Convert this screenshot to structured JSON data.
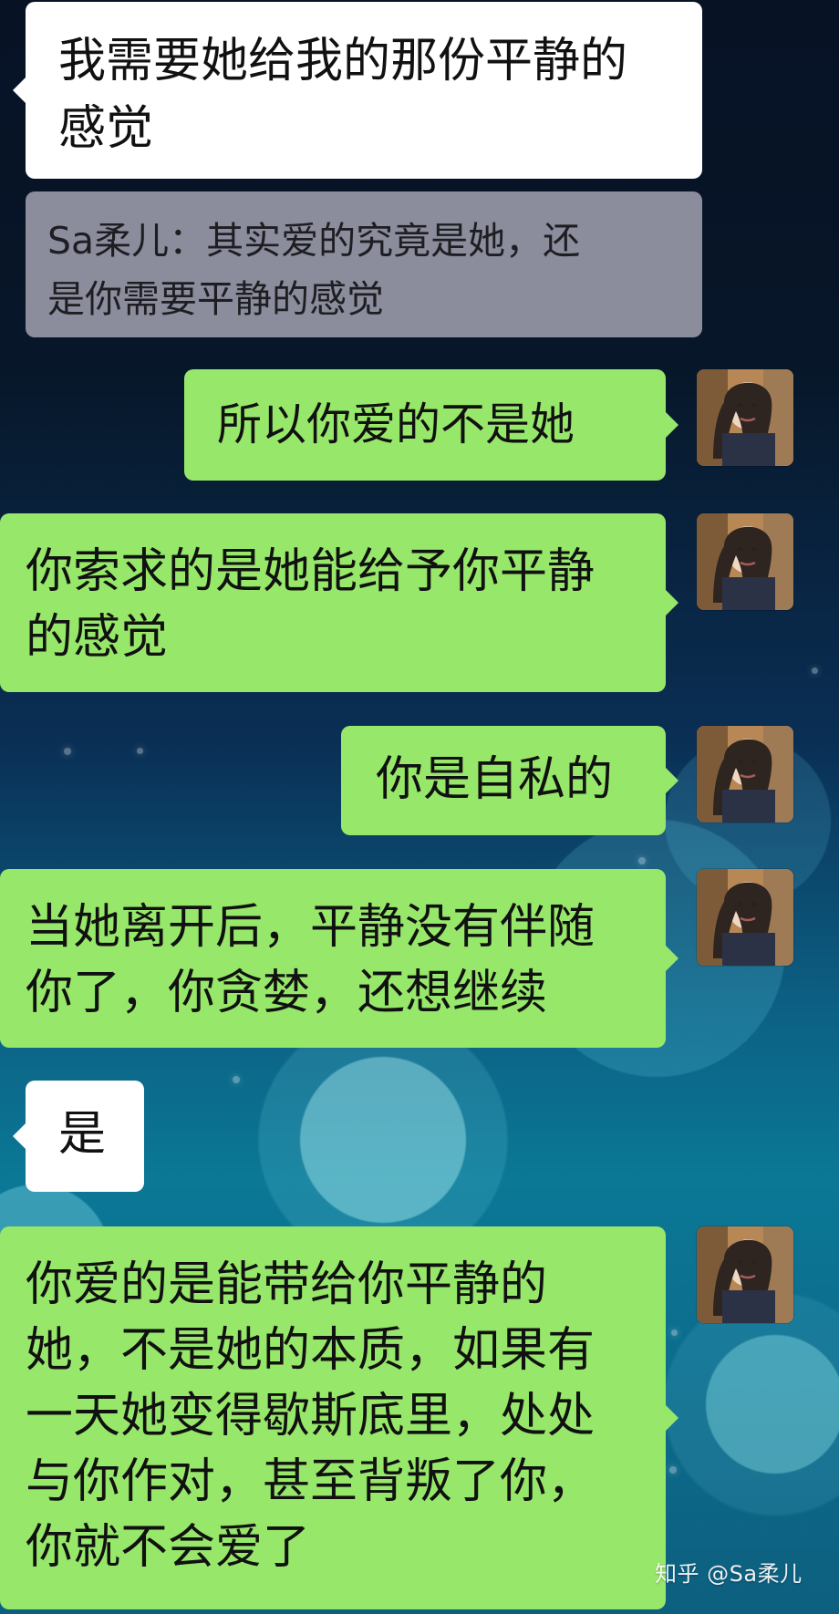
{
  "messages": [
    {
      "text": "我需要她给我的那份平静的\n感觉"
    },
    {
      "text": "Sa柔儿：其实爱的究竟是她，还\n是你需要平静的感觉"
    },
    {
      "text": "所以你爱的不是她"
    },
    {
      "text": "你索求的是她能给予你平静\n的感觉"
    },
    {
      "text": "你是自私的"
    },
    {
      "text": "当她离开后，平静没有伴随\n你了，你贪婪，还想继续"
    },
    {
      "text": "是"
    },
    {
      "text": "你爱的是能带给你平静的\n她，不是她的本质，如果有\n一天她变得歇斯底里，处处\n与你作对，甚至背叛了你，\n你就不会爱了"
    }
  ],
  "watermark": "知乎 @Sa柔儿",
  "colors": {
    "green_bubble": "#97e86a",
    "white_bubble": "#ffffff",
    "gray_bubble": "#8b8d9d"
  }
}
